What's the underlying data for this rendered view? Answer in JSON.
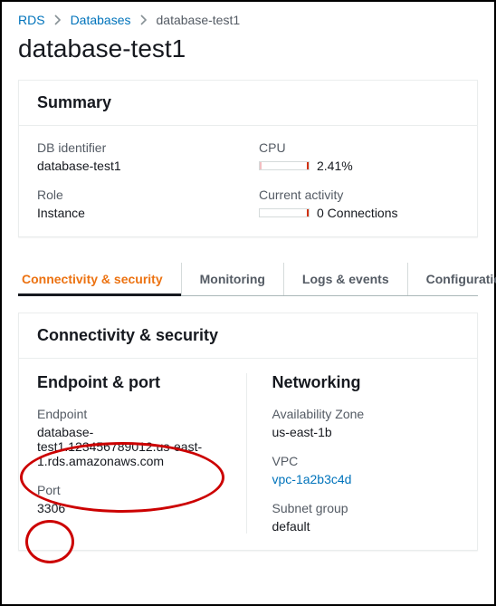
{
  "breadcrumbs": {
    "root": "RDS",
    "parent": "Databases",
    "current": "database-test1"
  },
  "page": {
    "title": "database-test1"
  },
  "summary": {
    "header": "Summary",
    "db_identifier_label": "DB identifier",
    "db_identifier_value": "database-test1",
    "role_label": "Role",
    "role_value": "Instance",
    "cpu_label": "CPU",
    "cpu_value": "2.41%",
    "cpu_percent": 2.41,
    "activity_label": "Current activity",
    "activity_value": "0 Connections",
    "activity_percent": 0
  },
  "tabs": {
    "connectivity": "Connectivity & security",
    "monitoring": "Monitoring",
    "logs": "Logs & events",
    "configuration": "Configuration"
  },
  "connectivity": {
    "header": "Connectivity & security",
    "endpoint_port_title": "Endpoint & port",
    "endpoint_label": "Endpoint",
    "endpoint_value": "database-test1.123456789012.us-east-1.rds.amazonaws.com",
    "port_label": "Port",
    "port_value": "3306",
    "networking_title": "Networking",
    "az_label": "Availability Zone",
    "az_value": "us-east-1b",
    "vpc_label": "VPC",
    "vpc_value": "vpc-1a2b3c4d",
    "subnet_label": "Subnet group",
    "subnet_value": "default"
  }
}
